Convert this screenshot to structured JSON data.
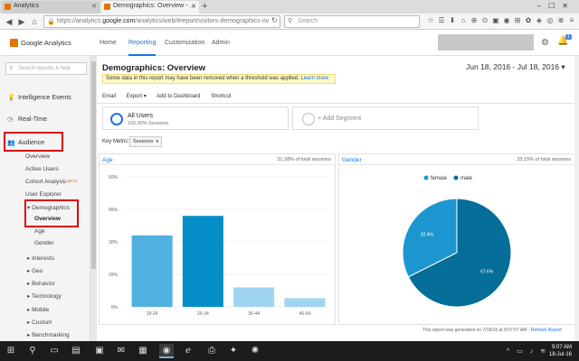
{
  "browser": {
    "tabs": [
      {
        "label": "Analytics"
      },
      {
        "label": "Demographics: Overview - ..."
      }
    ],
    "url_prefix": "https://analytics.",
    "url_domain": "google.com",
    "url_rest": "/analytics/web/#report/visitors-demographics-ov",
    "search_placeholder": "Search"
  },
  "ga_header": {
    "brand": "Google Analytics",
    "nav": [
      "Home",
      "Reporting",
      "Customization",
      "Admin"
    ],
    "notifications": "1"
  },
  "sidebar": {
    "search_placeholder": "Search reports & help",
    "main_items": [
      {
        "label": "Intelligence Events"
      },
      {
        "label": "Real-Time"
      },
      {
        "label": "Audience"
      }
    ],
    "audience_items": [
      {
        "label": "Overview"
      },
      {
        "label": "Active Users"
      },
      {
        "label": "Cohort Analysis",
        "badge": "BETA"
      },
      {
        "label": "User Explorer"
      },
      {
        "label": "▾ Demographics"
      }
    ],
    "demographics_items": [
      {
        "label": "Overview"
      },
      {
        "label": "Age"
      },
      {
        "label": "Gender"
      }
    ],
    "more_items": [
      {
        "label": "▸ Interests"
      },
      {
        "label": "▸ Geo"
      },
      {
        "label": "▸ Behavior"
      },
      {
        "label": "▸ Technology"
      },
      {
        "label": "▸ Mobile"
      },
      {
        "label": "▸ Custom"
      },
      {
        "label": "▸ Benchmarking"
      }
    ]
  },
  "main": {
    "title": "Demographics: Overview",
    "notice_text": "Some data in this report may have been removed when a threshold was applied.",
    "notice_link": "Learn more",
    "date_range": "Jun 18, 2016 - Jul 18, 2016 ▾",
    "actions": [
      "Email",
      "Export ▾",
      "Add to Dashboard",
      "Shortcut"
    ],
    "segment": {
      "name": "All Users",
      "sub": "100.00% Sessions"
    },
    "add_segment": "+ Add Segment",
    "key_metric_label": "Key Metric:",
    "key_metric_value": "Sessions",
    "age_panel": {
      "title": "Age",
      "pct": "31.28% of total sessions"
    },
    "gender_panel": {
      "title": "Gender",
      "pct": "33.15% of total sessions"
    },
    "footer_text": "This report was generated on 7/18/16 at 9:07:07 AM -",
    "footer_link": "Refresh Report"
  },
  "taskbar": {
    "time": "9:07 AM",
    "date": "18-Jul-16"
  },
  "colors": {
    "accent": "#1a73e8",
    "bar_dark": "#058dc7",
    "bar_mid": "#50b0e0",
    "bar_light": "#9fd5f0",
    "male": "#056e99",
    "female": "#1c96cf",
    "highlight": "#dd0000"
  },
  "chart_data": [
    {
      "type": "bar",
      "title": "Age",
      "categories": [
        "18-24",
        "25-34",
        "35-44",
        "45-54"
      ],
      "values": [
        33,
        42,
        9,
        4
      ],
      "yticks": [
        "0%",
        "15%",
        "30%",
        "45%",
        "60%"
      ],
      "ylim": [
        0,
        60
      ],
      "grid": true
    },
    {
      "type": "pie",
      "title": "Gender",
      "labels": [
        "female",
        "male"
      ],
      "values": [
        32.4,
        67.6
      ],
      "value_labels": [
        "32.4%",
        "67.6%"
      ],
      "legend": "top"
    }
  ]
}
